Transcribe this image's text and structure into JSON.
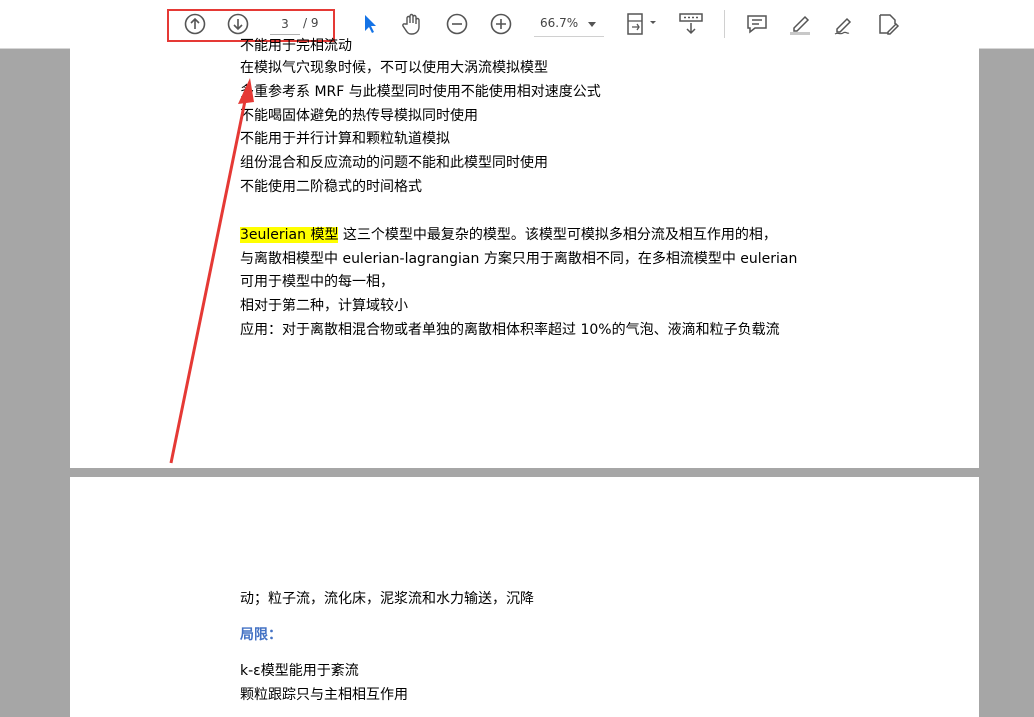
{
  "toolbar": {
    "current_page": "3",
    "total_pages": "/ 9",
    "zoom": "66.7%",
    "accent_color": "#1473e6",
    "highlight_color": "#e53935",
    "icons": [
      "arrow-up-circle-icon",
      "arrow-down-circle-icon",
      "select-cursor-icon",
      "hand-icon",
      "zoom-out-icon",
      "zoom-in-icon",
      "fit-page-icon",
      "scroll-mode-icon",
      "comment-icon",
      "highlight-pen-icon",
      "sign-icon",
      "edit-pdf-icon"
    ]
  },
  "page1": {
    "top_partial_line": "不能用于完相流动",
    "lines": [
      "在模拟气穴现象时候，不可以使用大涡流模拟模型",
      "多重参考系 MRF 与此模型同时使用不能使用相对速度公式",
      "不能喝固体避免的热传导模拟同时使用",
      "不能用于并行计算和颗粒轨道模拟",
      "组份混合和反应流动的问题不能和此模型同时使用",
      "不能使用二阶稳式的时间格式"
    ],
    "para_highlight": "3eulerian 模型",
    "para_rest": " 这三个模型中最复杂的模型。该模型可模拟多相分流及相互作用的相，",
    "para_lines": [
      "与离散相模型中 eulerian-lagrangian 方案只用于离散相不同，在多相流模型中 eulerian",
      "可用于模型中的每一相，",
      "相对于第二种，计算域较小",
      "应用：对于离散相混合物或者单独的离散相体积率超过 10%的气泡、液滴和粒子负载流"
    ]
  },
  "page2": {
    "lines": [
      "动；粒子流，流化床，泥浆流和水力输送，沉降"
    ],
    "heading": "局限：",
    "after_lines": [
      "k-ε模型能用于紊流",
      "颗粒跟踪只与主相相互作用"
    ]
  }
}
